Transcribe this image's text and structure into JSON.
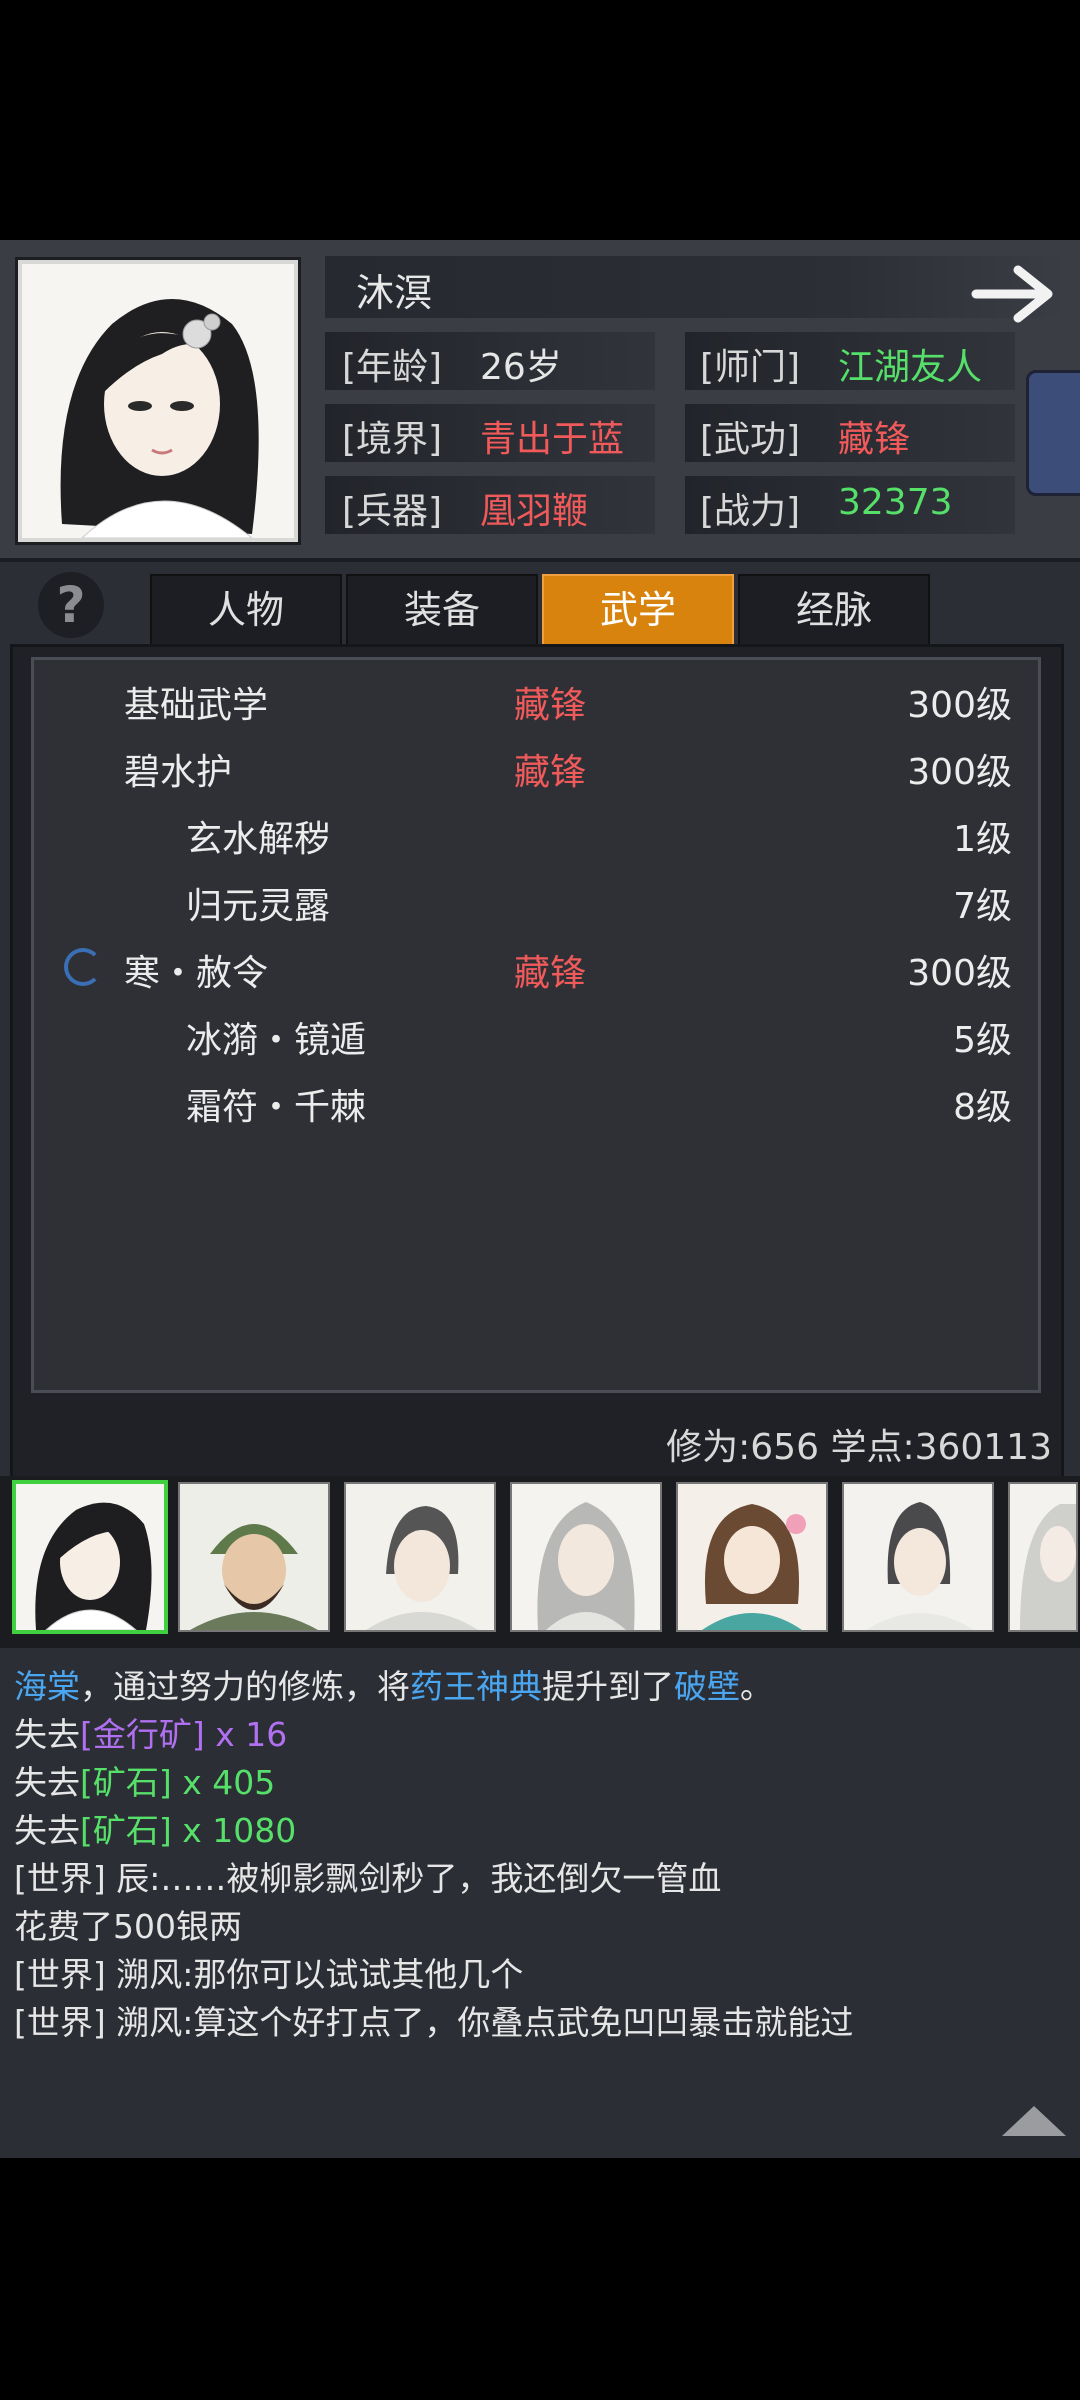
{
  "header": {
    "name": "沐溟",
    "stats": [
      {
        "label": "[年龄]",
        "value": "26岁",
        "color": "#e6e6e6"
      },
      {
        "label": "[师门]",
        "value": "江湖友人",
        "color": "#56e06a"
      },
      {
        "label": "[境界]",
        "value": "青出于蓝",
        "color": "#f05a5a"
      },
      {
        "label": "[武功]",
        "value": "藏锋",
        "color": "#f05a5a"
      },
      {
        "label": "[兵器]",
        "value": "凰羽鞭",
        "color": "#f05a5a"
      },
      {
        "label": "[战力]",
        "value": "32373",
        "color": "#56e06a"
      }
    ]
  },
  "tabs": [
    {
      "label": "人物",
      "active": false
    },
    {
      "label": "装备",
      "active": false
    },
    {
      "label": "武学",
      "active": true
    },
    {
      "label": "经脉",
      "active": false
    }
  ],
  "skills": [
    {
      "name": "基础武学",
      "style": "藏锋",
      "level": "300级",
      "indent": false,
      "icon": null
    },
    {
      "name": "碧水护",
      "style": "藏锋",
      "level": "300级",
      "indent": false,
      "icon": null
    },
    {
      "name": "玄水解秽",
      "style": "",
      "level": "1级",
      "indent": true,
      "icon": null
    },
    {
      "name": "归元灵露",
      "style": "",
      "level": "7级",
      "indent": true,
      "icon": null
    },
    {
      "name": "寒・赦令",
      "style": "藏锋",
      "level": "300级",
      "indent": false,
      "icon": "loading-spinner-icon"
    },
    {
      "name": "冰漪・镜遁",
      "style": "",
      "level": "5级",
      "indent": true,
      "icon": null
    },
    {
      "name": "霜符・千棘",
      "style": "",
      "level": "8级",
      "indent": true,
      "icon": null
    }
  ],
  "footer": {
    "xiuwei": "修为:656",
    "xuedian": "学点:360113"
  },
  "characters": [
    "character-portrait-1",
    "character-portrait-2",
    "character-portrait-3",
    "character-portrait-4",
    "character-portrait-5",
    "character-portrait-6",
    "character-portrait-7"
  ],
  "chat": {
    "l1": {
      "a": "海棠",
      "b": "，通过努力的修炼，将",
      "c": "药王神典",
      "d": "提升到了",
      "e": "破壁",
      "f": "。"
    },
    "l2": {
      "a": "失去",
      "b": "[金行矿] x 16"
    },
    "l3": {
      "a": "失去",
      "b": "[矿石] x 405"
    },
    "l4": {
      "a": "失去",
      "b": "[矿石] x 1080"
    },
    "l5": "[世界] 辰:……被柳影飘剑秒了，我还倒欠一管血",
    "l6": "花费了500银两",
    "l7": "[世界] 溯风:那你可以试试其他几个",
    "l8": "[世界] 溯风:算这个好打点了，你叠点武免凹凹暴击就能过"
  }
}
